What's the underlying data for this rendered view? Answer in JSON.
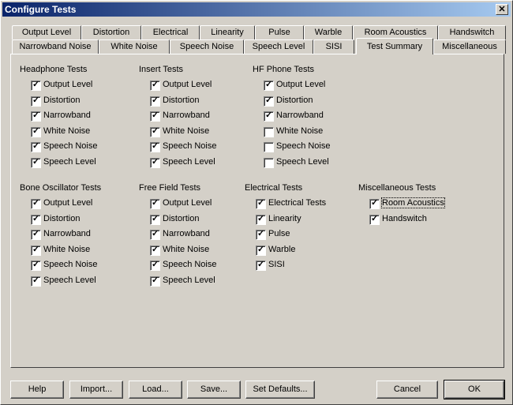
{
  "window": {
    "title": "Configure Tests",
    "close_glyph": "✕"
  },
  "tabs_row1": [
    "Output Level",
    "Distortion",
    "Electrical",
    "Linearity",
    "Pulse",
    "Warble",
    "Room Acoustics",
    "Handswitch"
  ],
  "tabs_row2": [
    "Narrowband Noise",
    "White Noise",
    "Speech Noise",
    "Speech Level",
    "SISI",
    "Test Summary",
    "Miscellaneous"
  ],
  "active_tab": "Test Summary",
  "groups": [
    {
      "title": "Headphone Tests",
      "items": [
        {
          "label": "Output Level",
          "checked": true
        },
        {
          "label": "Distortion",
          "checked": true
        },
        {
          "label": "Narrowband",
          "checked": true
        },
        {
          "label": "White Noise",
          "checked": true
        },
        {
          "label": "Speech Noise",
          "checked": true
        },
        {
          "label": "Speech Level",
          "checked": true
        }
      ]
    },
    {
      "title": "Insert Tests",
      "items": [
        {
          "label": "Output Level",
          "checked": true
        },
        {
          "label": "Distortion",
          "checked": true
        },
        {
          "label": "Narrowband",
          "checked": true
        },
        {
          "label": "White Noise",
          "checked": true
        },
        {
          "label": "Speech Noise",
          "checked": true
        },
        {
          "label": "Speech Level",
          "checked": true
        }
      ]
    },
    {
      "title": "HF Phone Tests",
      "items": [
        {
          "label": "Output Level",
          "checked": true
        },
        {
          "label": "Distortion",
          "checked": true
        },
        {
          "label": "Narrowband",
          "checked": true
        },
        {
          "label": "White Noise",
          "checked": false
        },
        {
          "label": "Speech Noise",
          "checked": false
        },
        {
          "label": "Speech Level",
          "checked": false
        }
      ]
    },
    {
      "title": "Bone Oscillator Tests",
      "items": [
        {
          "label": "Output Level",
          "checked": true
        },
        {
          "label": "Distortion",
          "checked": true
        },
        {
          "label": "Narrowband",
          "checked": true
        },
        {
          "label": "White Noise",
          "checked": true
        },
        {
          "label": "Speech Noise",
          "checked": true
        },
        {
          "label": "Speech Level",
          "checked": true
        }
      ]
    },
    {
      "title": "Free Field Tests",
      "items": [
        {
          "label": "Output Level",
          "checked": true
        },
        {
          "label": "Distortion",
          "checked": true
        },
        {
          "label": "Narrowband",
          "checked": true
        },
        {
          "label": "White Noise",
          "checked": true
        },
        {
          "label": "Speech Noise",
          "checked": true
        },
        {
          "label": "Speech Level",
          "checked": true
        }
      ]
    },
    {
      "title": "Electrical Tests",
      "items": [
        {
          "label": "Electrical Tests",
          "checked": true
        },
        {
          "label": "Linearity",
          "checked": true
        },
        {
          "label": "Pulse",
          "checked": true
        },
        {
          "label": "Warble",
          "checked": true
        },
        {
          "label": "SISI",
          "checked": true
        }
      ]
    },
    {
      "title": "Miscellaneous Tests",
      "items": [
        {
          "label": "Room Acoustics",
          "checked": true
        },
        {
          "label": "Handswitch",
          "checked": true
        }
      ]
    }
  ],
  "buttons": {
    "help": "Help",
    "import": "Import...",
    "load": "Load...",
    "save": "Save...",
    "set_defaults": "Set Defaults...",
    "cancel": "Cancel",
    "ok": "OK"
  }
}
